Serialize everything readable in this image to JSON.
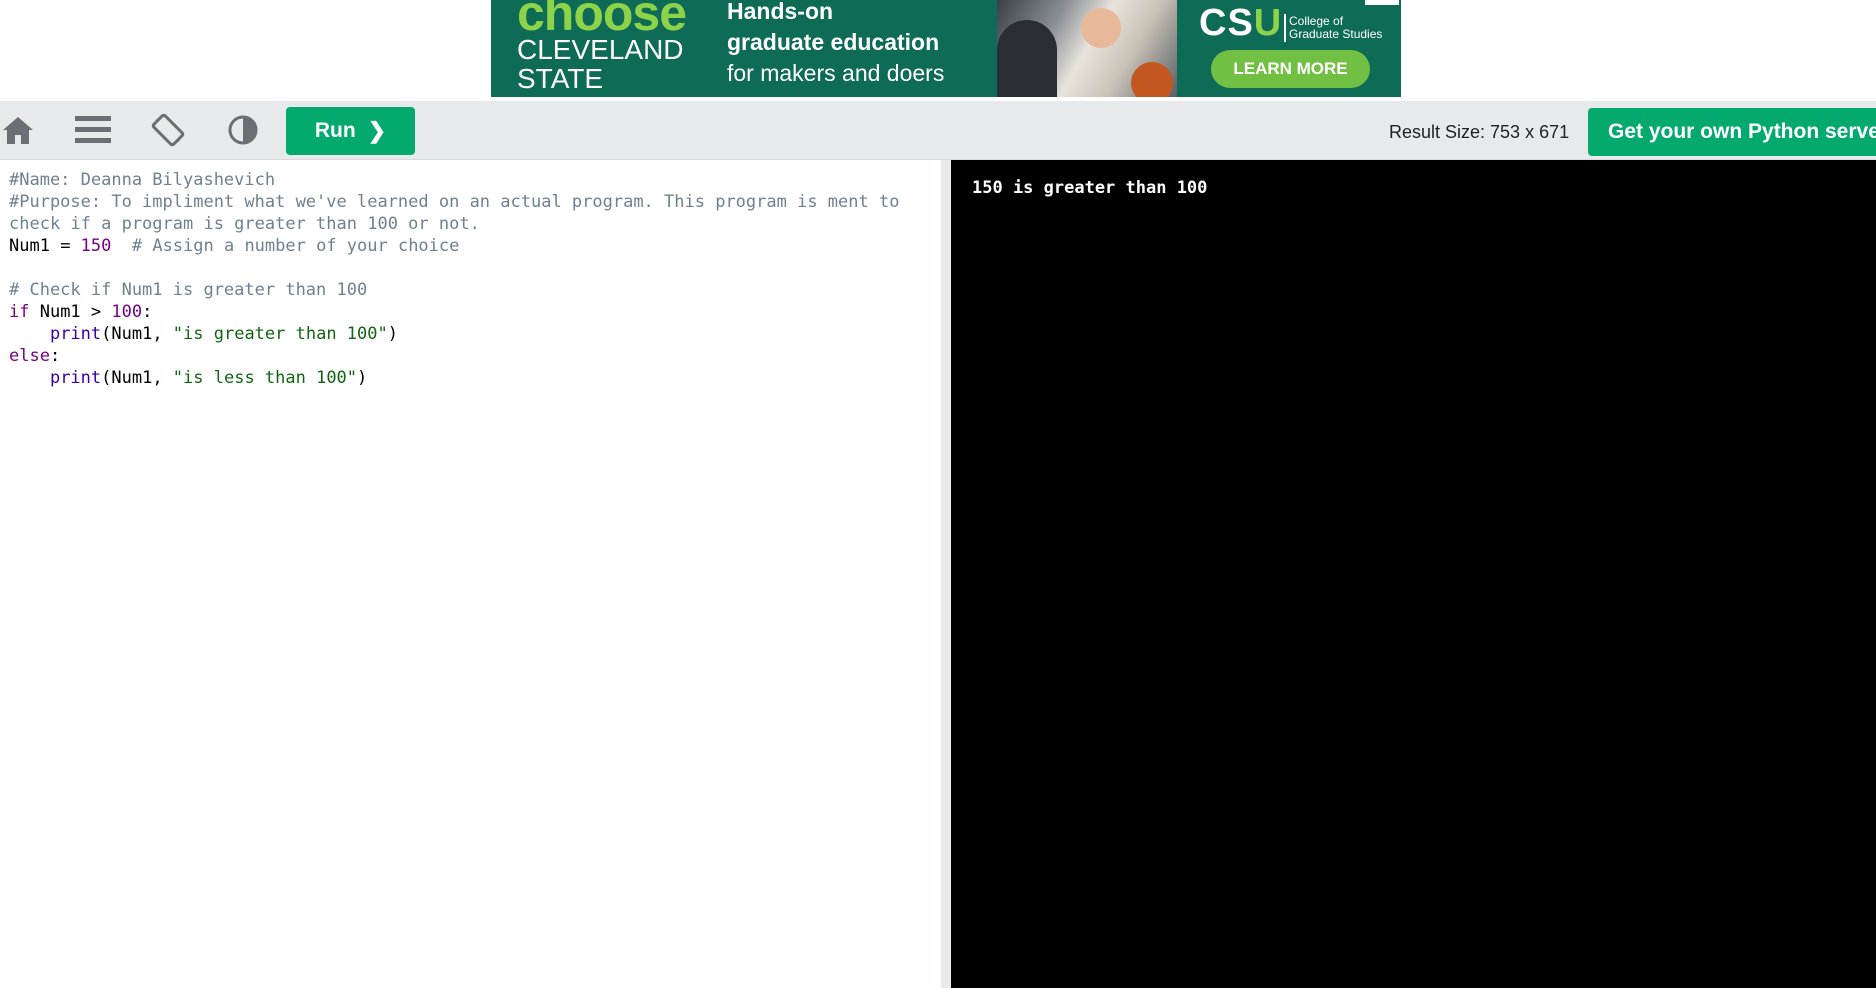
{
  "ad": {
    "choose": "choose",
    "cleveland": "CLEVELAND",
    "state": "STATE",
    "line1": "Hands-on",
    "line2": "graduate education",
    "line3": "for makers and doers",
    "logo_cs": "CS",
    "logo_u": "U",
    "college_line1": "College of",
    "college_line2": "Graduate Studies",
    "cta": "LEARN MORE",
    "colors": {
      "background": "#0e6b56",
      "accent": "#8dd34a",
      "button": "#72c043"
    }
  },
  "toolbar": {
    "icons": [
      "home-icon",
      "menu-icon",
      "rotate-icon",
      "contrast-icon"
    ],
    "run_label": "Run",
    "run_chevron": "❯",
    "result_size": "Result Size: 753 x 671",
    "own_server_label": "Get your own Python server",
    "colors": {
      "background": "#e7e9eb",
      "button": "#04aa6d"
    }
  },
  "editor": {
    "lines": {
      "l1": "#Name: Deanna Bilyashevich",
      "l2": "#Purpose: To impliment what we've learned on an actual program. This program is ment to",
      "l3": "check if a program is greater than 100 or not.",
      "l4_var": "Num1",
      "l4_eq": " = ",
      "l4_num": "150",
      "l4_com": "  # Assign a number of your choice",
      "l6": "# Check if Num1 is greater than 100",
      "l7_kw": "if",
      "l7_mid": " Num1 > ",
      "l7_num": "100",
      "l7_end": ":",
      "l8_indent": "    ",
      "l8_fn": "print",
      "l8_args": "(Num1, ",
      "l8_str": "\"is greater than 100\"",
      "l8_close": ")",
      "l9_kw": "else",
      "l9_end": ":",
      "l10_indent": "    ",
      "l10_fn": "print",
      "l10_args": "(Num1, ",
      "l10_str": "\"is less than 100\"",
      "l10_close": ")"
    }
  },
  "result": {
    "output": "150 is greater than 100",
    "colors": {
      "background": "#000000",
      "text": "#ffffff"
    }
  }
}
